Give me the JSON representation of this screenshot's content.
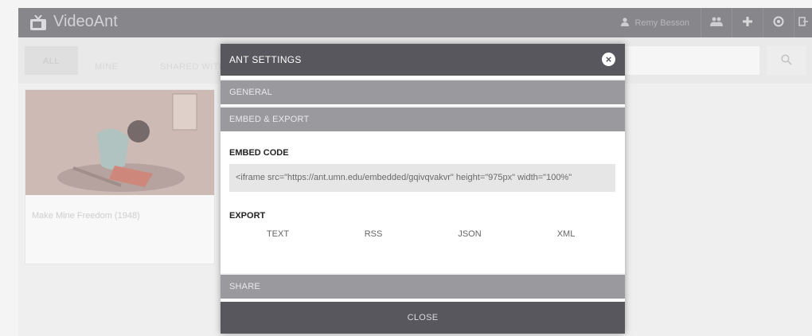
{
  "app": {
    "name": "VideoAnt"
  },
  "topbar": {
    "user_name": "Remy Besson",
    "icons": [
      "user-icon",
      "group-icon",
      "plus-icon",
      "globe-icon",
      "logout-icon"
    ]
  },
  "filters": {
    "tabs": [
      "ALL",
      "MINE",
      "SHARED WITH ME"
    ]
  },
  "search": {
    "icon": "search-icon"
  },
  "videos": [
    {
      "title": "Make Mine Freedom (1948)"
    }
  ],
  "modal": {
    "title": "ANT SETTINGS",
    "sections": {
      "general": "GENERAL",
      "embed_export": "EMBED & EXPORT",
      "share": "SHARE"
    },
    "embed_label": "EMBED CODE",
    "embed_code": "<iframe src=\"https://ant.umn.edu/embedded/gqivqvakvr\" height=\"975px\" width=\"100%\"",
    "export_label": "EXPORT",
    "export_options": [
      "TEXT",
      "RSS",
      "JSON",
      "XML"
    ],
    "close_label": "CLOSE"
  },
  "colors": {
    "header": "#6d6d72",
    "modal_header": "#57575d",
    "section": "#9a9a9e"
  }
}
